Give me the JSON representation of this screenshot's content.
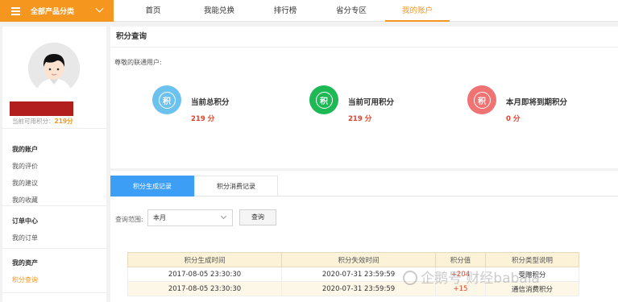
{
  "topbar": {
    "category_label": "全部产品分类",
    "nav": [
      "首页",
      "我能兑换",
      "排行榜",
      "省分专区",
      "我的账户"
    ],
    "active_tab": "我的账户"
  },
  "sidebar": {
    "points_text": "当前可用积分：",
    "points_value": "219分",
    "groups": [
      {
        "title": "我的账户",
        "items": [
          "我的评价",
          "我的建议",
          "我的收藏"
        ]
      },
      {
        "title": "订单中心",
        "items": [
          "我的订单"
        ]
      },
      {
        "title": "我的资产",
        "items": [
          "积分查询"
        ]
      }
    ],
    "active_item": "积分查询"
  },
  "points_panel": {
    "title": "积分查询",
    "greeting": "尊敬的联通用户:",
    "icon_char": "积",
    "stats": [
      {
        "label": "当前总积分",
        "value": "219 分",
        "color": "#6cc2ee"
      },
      {
        "label": "当前可用积分",
        "value": "219 分",
        "color": "#1db954"
      },
      {
        "label": "本月即将到期积分",
        "value": "0 分",
        "color": "#f07272"
      }
    ]
  },
  "records": {
    "tabs": [
      "积分生成记录",
      "积分消费记录"
    ],
    "active_tab": "积分生成记录",
    "range_label": "查询范围:",
    "range_value": "本月",
    "query_button": "查询",
    "columns": [
      "积分生成时间",
      "积分失效时间",
      "积分值",
      "积分类型说明"
    ],
    "rows": [
      [
        "2017-08-05 23:30:30",
        "2020-07-31 23:59:59",
        "+204",
        "受赠积分"
      ],
      [
        "2017-08-05 23:30:30",
        "2020-07-31 23:59:59",
        "+15",
        "通信消费积分"
      ]
    ]
  },
  "watermark": "企鹅号 财经babala",
  "colors": {
    "accent": "#f5961f",
    "tab_active": "#3d9ef5",
    "value_red": "#e0402a"
  }
}
